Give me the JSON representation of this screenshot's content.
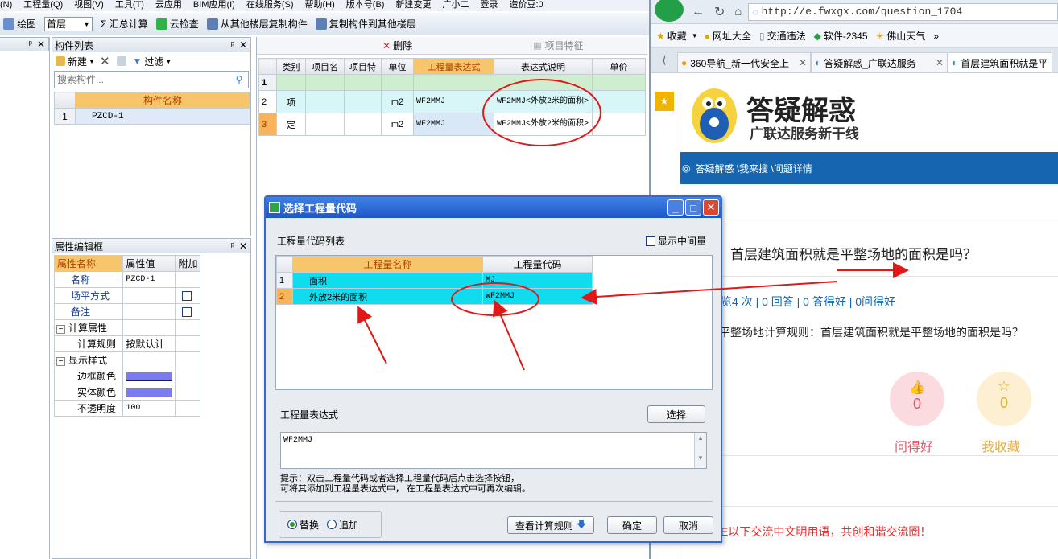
{
  "app": {
    "menu": [
      "(N)",
      "工程量(Q)",
      "视图(V)",
      "工具(T)",
      "云应用",
      "BIM应用(I)",
      "在线服务(S)",
      "帮助(H)",
      "版本号(B)",
      "新建变更",
      "广小二",
      "登录",
      "造价豆:0"
    ],
    "toolbar": {
      "draw": "绘图",
      "floor": "首层",
      "sum": "Σ 汇总计算",
      "cloud_check": "云检查",
      "copy_from": "从其他楼层复制构件",
      "copy_to": "复制构件到其他楼层"
    }
  },
  "component_list": {
    "title": "构件列表",
    "new": "新建",
    "filter": "过滤",
    "search_placeholder": "搜索构件...",
    "col": "构件名称",
    "rows": [
      {
        "num": "1",
        "name": "PZCD-1"
      }
    ]
  },
  "props": {
    "title": "属性编辑框",
    "headers": [
      "属性名称",
      "属性值",
      "附加"
    ],
    "rows": [
      {
        "name": "名称",
        "value": "PZCD-1"
      },
      {
        "name": "场平方式",
        "value": ""
      },
      {
        "name": "备注",
        "value": ""
      },
      {
        "name": "计算属性",
        "value": ""
      },
      {
        "name": "计算规则",
        "value": "按默认计"
      },
      {
        "name": "显示样式",
        "value": ""
      },
      {
        "name": "边框颜色",
        "value": ""
      },
      {
        "name": "实体颜色",
        "value": ""
      },
      {
        "name": "不透明度",
        "value": "100"
      }
    ],
    "swatch_color": "#7b7bf0"
  },
  "qty_table": {
    "delete": "删除",
    "feature": "项目特征",
    "headers": [
      "类别",
      "项目名",
      "项目特",
      "单位",
      "工程量表达式",
      "表达式说明",
      "单价"
    ],
    "rows": [
      {
        "num": "1",
        "type": "",
        "unit": "",
        "expr": "",
        "desc": ""
      },
      {
        "num": "2",
        "type": "项",
        "unit": "m2",
        "expr": "WF2MMJ",
        "desc": "WF2MMJ<外放2米的面积>"
      },
      {
        "num": "3",
        "type": "定",
        "unit": "m2",
        "expr": "WF2MMJ",
        "desc": "WF2MMJ<外放2米的面积>"
      }
    ]
  },
  "dialog": {
    "title": "选择工程量代码",
    "list_label": "工程量代码列表",
    "show_mid": "显示中间量",
    "col_name": "工程量名称",
    "col_code": "工程量代码",
    "rows": [
      {
        "num": "1",
        "name": "面积",
        "code": "MJ"
      },
      {
        "num": "2",
        "name": "外放2米的面积",
        "code": "WF2MMJ"
      }
    ],
    "expr_label": "工程量表达式",
    "select_btn": "选择",
    "expr_value": "WF2MMJ",
    "hint1": "提示：双击工程量代码或者选择工程量代码后点击选择按钮，",
    "hint2": "可将其添加到工程量表达式中， 在工程量表达式中可再次编辑。",
    "replace": "替换",
    "append": "追加",
    "rule_btn": "查看计算规则",
    "ok": "确定",
    "cancel": "取消"
  },
  "browser": {
    "url": "http://e.fwxgx.com/question_1704",
    "bookmarks": [
      "收藏",
      "网址大全",
      "交通违法",
      "软件-2345",
      "佛山天气"
    ],
    "tabs": [
      "360导航_新一代安全上",
      "答疑解惑_广联达服务",
      "首层建筑面积就是平"
    ],
    "logo_title": "答疑解惑",
    "logo_sub": "广联达服务新干线",
    "breadcrumb": "答疑解惑 \\我来搜 \\问题详情",
    "question": "首层建筑面积就是平整场地的面积是吗？",
    "stats": "览4 次 | 0 回答 | 0 答得好 | 0问得好",
    "desc": "平整场地计算规则：首层建筑面积就是平整场地的面积是吗？",
    "like_count": "0",
    "like_label": "问得好",
    "fav_count": "0",
    "fav_label": "我收藏",
    "notice": "E以下交流中文明用语，共创和谐交流圈！",
    "accent": "#1565b0"
  }
}
